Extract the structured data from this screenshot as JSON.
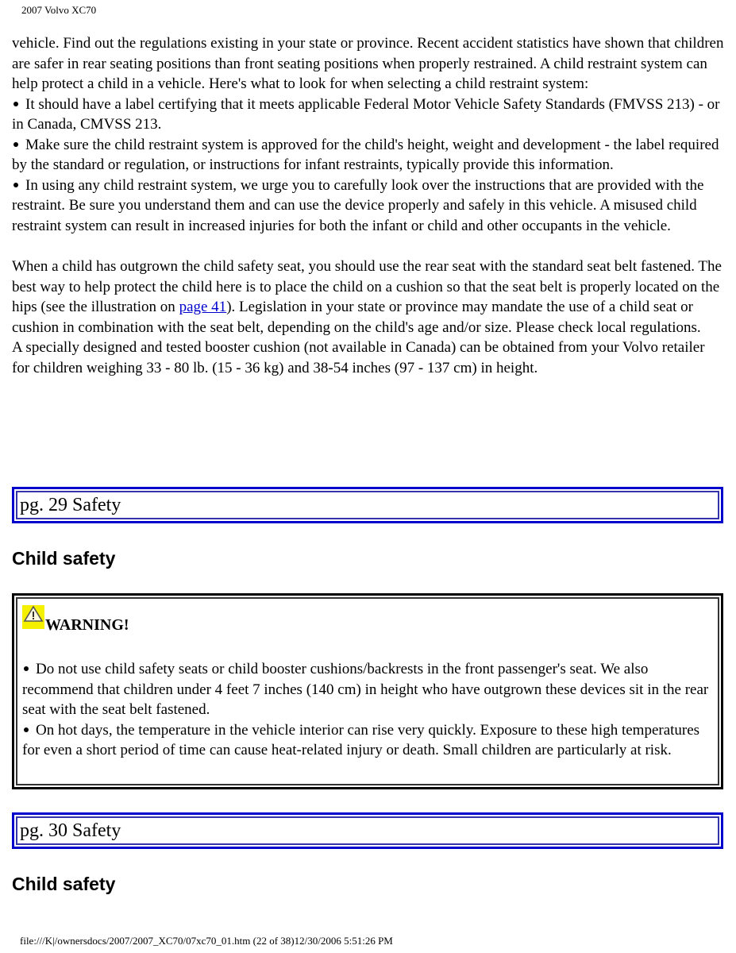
{
  "header": {
    "title": "2007 Volvo XC70"
  },
  "intro": {
    "paragraph": "vehicle. Find out the regulations existing in your state or province. Recent accident statistics have shown that children are safer in rear seating positions than front seating positions when properly restrained. A child restraint system can help protect a child in a vehicle. Here's what to look for when selecting a child restraint system:",
    "bullets": [
      "It should have a label certifying that it meets applicable Federal Motor Vehicle Safety Standards (FMVSS 213) - or in Canada, CMVSS 213.",
      "Make sure the child restraint system is approved for the child's height, weight and development - the label required by the standard or regulation, or instructions for infant restraints, typically provide this information.",
      "In using any child restraint system, we urge you to carefully look over the instructions that are provided with the restraint. Be sure you understand them and can use the device properly and safely in this vehicle. A misused child restraint system can result in increased injuries for both the infant or child and other occupants in the vehicle."
    ]
  },
  "outgrown": {
    "text_before_link": "When a child has outgrown the child safety seat, you should use the rear seat with the standard seat belt fastened. The best way to help protect the child here is to place the child on a cushion so that the seat belt is properly located on the hips (see the illustration on ",
    "link_label": "page 41",
    "text_after_link": "). Legislation in your state or province may mandate the use of a child seat or cushion in combination with the seat belt, depending on the child's age and/or size. Please check local regulations.",
    "booster_text": "A specially designed and tested booster cushion (not available in Canada) can be obtained from your Volvo retailer for children weighing 33 - 80 lb. (15 - 36 kg) and 38-54 inches (97 - 137 cm) in height."
  },
  "sections": [
    {
      "page_label": "pg. 29 Safety",
      "heading": "Child safety"
    },
    {
      "page_label": "pg. 30 Safety",
      "heading": "Child safety"
    }
  ],
  "warning": {
    "icon": "warning-triangle-icon",
    "title": "WARNING!",
    "bullets": [
      "Do not use child safety seats or child booster cushions/backrests in the front passenger's seat. We also recommend that children under 4 feet 7 inches (140 cm) in height who have outgrown these devices sit in the rear seat with the seat belt fastened.",
      "On hot days, the temperature in the vehicle interior can rise very quickly. Exposure to these high temperatures for even a short period of time can cause heat-related injury or death. Small children are particularly at risk."
    ]
  },
  "colors": {
    "page_box_border": "#0000cc",
    "link": "#0000cc",
    "warning_icon_bg": "#f5f000"
  },
  "footer": {
    "text": "file:///K|/ownersdocs/2007/2007_XC70/07xc70_01.htm (22 of 38)12/30/2006 5:51:26 PM"
  }
}
